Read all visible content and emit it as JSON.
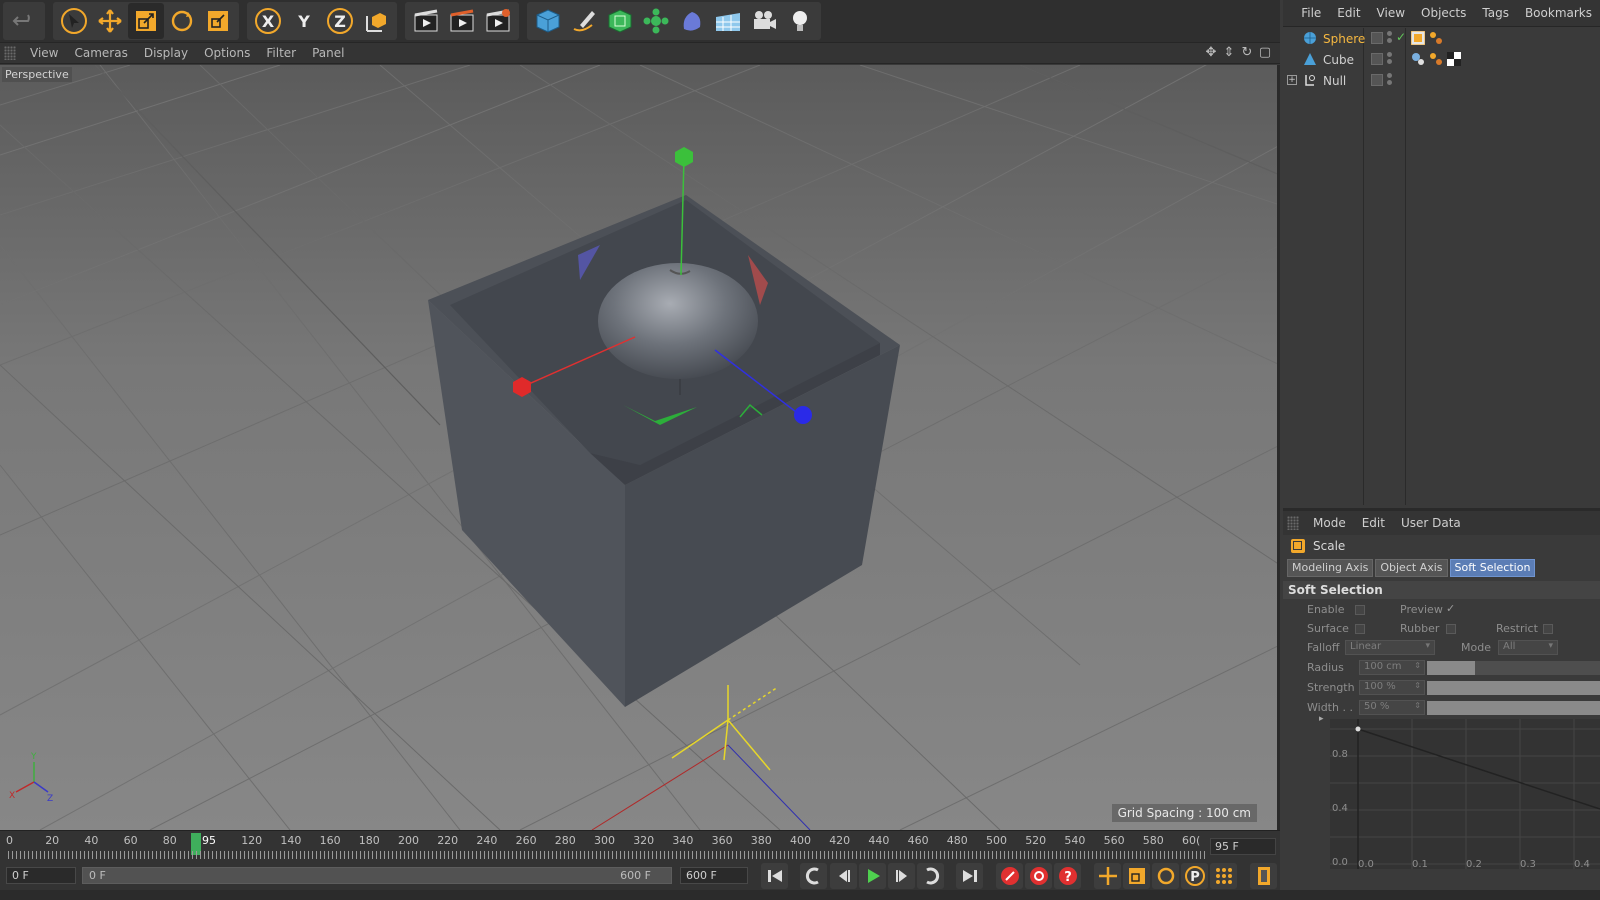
{
  "main_toolbar": {
    "groups": [
      {
        "items": [
          {
            "name": "undo-icon"
          }
        ]
      },
      {
        "items": [
          {
            "name": "select-arrow-icon"
          },
          {
            "name": "move-icon"
          },
          {
            "name": "scale-icon",
            "active": true
          },
          {
            "name": "rotate-icon"
          },
          {
            "name": "recent-tool-icon"
          }
        ]
      },
      {
        "items": [
          {
            "name": "x-axis-lock-icon",
            "glyph": "X"
          },
          {
            "name": "y-axis-lock-icon",
            "glyph": "Y"
          },
          {
            "name": "z-axis-lock-icon",
            "glyph": "Z"
          },
          {
            "name": "coordinate-system-icon"
          }
        ]
      },
      {
        "items": [
          {
            "name": "render-view-icon"
          },
          {
            "name": "render-picture-viewer-icon"
          },
          {
            "name": "render-settings-icon"
          }
        ]
      },
      {
        "items": [
          {
            "name": "cube-object-icon"
          },
          {
            "name": "pen-spline-icon"
          },
          {
            "name": "subdivision-icon"
          },
          {
            "name": "cloner-icon"
          },
          {
            "name": "deformer-icon"
          },
          {
            "name": "floor-scene-icon"
          },
          {
            "name": "camera-icon"
          },
          {
            "name": "light-icon"
          }
        ]
      }
    ]
  },
  "viewport": {
    "menu": [
      "View",
      "Cameras",
      "Display",
      "Options",
      "Filter",
      "Panel"
    ],
    "label": "Perspective",
    "grid_spacing": "Grid Spacing : 100 cm",
    "axis_labels": {
      "x": "X",
      "y": "Y",
      "z": "Z"
    }
  },
  "timeline": {
    "ticks": [
      "0",
      "20",
      "40",
      "60",
      "80",
      "95",
      "120",
      "140",
      "160",
      "180",
      "200",
      "220",
      "240",
      "260",
      "280",
      "300",
      "320",
      "340",
      "360",
      "380",
      "400",
      "420",
      "440",
      "460",
      "480",
      "500",
      "520",
      "540",
      "560",
      "580",
      "60("
    ],
    "current_frame": "95 F",
    "current_frame_value": 95,
    "max_frame": 600
  },
  "transport": {
    "start_field": "0 F",
    "range_start": "0 F",
    "range_end": "600 F",
    "end_field": "600 F"
  },
  "object_manager": {
    "menu": [
      "File",
      "Edit",
      "View",
      "Objects",
      "Tags",
      "Bookmarks"
    ],
    "objects": [
      {
        "name": "Sphere",
        "active": true,
        "icon": "sphere-icon"
      },
      {
        "name": "Cube",
        "active": false,
        "icon": "cube-deformed-icon"
      },
      {
        "name": "Null",
        "active": false,
        "icon": "null-object-icon",
        "expander": "+"
      }
    ]
  },
  "attribute_manager": {
    "menu": [
      "Mode",
      "Edit",
      "User Data"
    ],
    "tool_name": "Scale",
    "tabs": [
      {
        "label": "Modeling Axis",
        "active": false
      },
      {
        "label": "Object Axis",
        "active": false
      },
      {
        "label": "Soft Selection",
        "active": true
      }
    ],
    "section": "Soft Selection",
    "props": {
      "enable": "Enable",
      "preview": "Preview",
      "preview_check": "✓",
      "surface": "Surface",
      "rubber": "Rubber",
      "restrict": "Restrict",
      "falloff": "Falloff",
      "falloff_value": "Linear",
      "mode": "Mode",
      "mode_value": "All",
      "radius": "Radius",
      "radius_value": "100 cm",
      "strength": "Strength",
      "strength_value": "100 %",
      "width": "Width . .",
      "width_value": "50 %"
    },
    "slider_levels": {
      "radius": 0.28,
      "strength": 1.0,
      "width": 1.0
    },
    "graph": {
      "y_labels": [
        "0.8",
        "0.4",
        "0.0"
      ],
      "x_labels": [
        "0.0",
        "0.1",
        "0.2",
        "0.3",
        "0.4"
      ]
    }
  },
  "colors": {
    "accent_orange": "#f2a82b",
    "active_tab": "#5b7db5",
    "axis_x": "#e02020",
    "axis_y": "#3fae3f",
    "axis_z": "#2020e0",
    "playhead": "#3fae5c"
  }
}
